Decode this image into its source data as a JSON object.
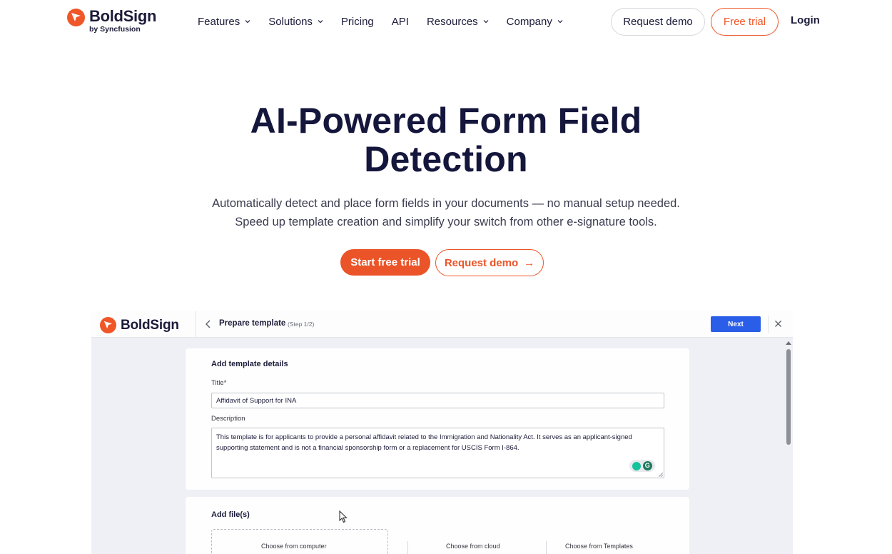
{
  "brand": {
    "name": "BoldSign",
    "byline": "by Syncfusion",
    "accent": "#ef5628",
    "navy": "#14163c"
  },
  "nav": {
    "items": [
      {
        "label": "Features",
        "has_dropdown": true
      },
      {
        "label": "Solutions",
        "has_dropdown": true
      },
      {
        "label": "Pricing",
        "has_dropdown": false
      },
      {
        "label": "API",
        "has_dropdown": false
      },
      {
        "label": "Resources",
        "has_dropdown": true
      },
      {
        "label": "Company",
        "has_dropdown": true
      }
    ],
    "request_demo": "Request demo",
    "free_trial": "Free trial",
    "login": "Login"
  },
  "hero": {
    "title_line1": "AI-Powered Form Field",
    "title_line2": "Detection",
    "subtitle_line1": "Automatically detect and place form fields in your documents — no manual setup needed.",
    "subtitle_line2": "Speed up template creation and simplify your switch from other e-signature tools.",
    "cta_primary": "Start free trial",
    "cta_secondary": "Request demo",
    "cta_secondary_arrow": "→"
  },
  "app": {
    "logo_name": "BoldSign",
    "step_title": "Prepare template",
    "step_num": "(Step 1/2)",
    "next_label": "Next",
    "details": {
      "heading": "Add template details",
      "title_label": "Title*",
      "title_value": "Affidavit of Support for INA",
      "description_label": "Description",
      "description_value": "This template is for applicants to provide a personal affidavit related to the Immigration and Nationality Act. It serves as an applicant-signed supporting statement and is not a financial sponsorship form or a replacement for USCIS Form I-864.",
      "grammarly_letter": "G"
    },
    "files": {
      "heading": "Add file(s)",
      "option_computer": "Choose from computer",
      "option_cloud": "Choose from cloud",
      "option_templates": "Choose from Templates"
    }
  }
}
